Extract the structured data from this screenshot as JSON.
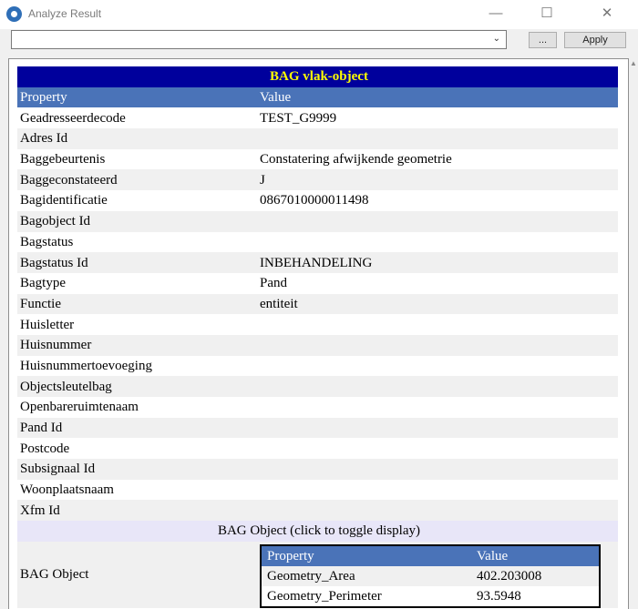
{
  "window": {
    "title": "Analyze Result",
    "minimize": "—",
    "maximize": "☐",
    "close": "✕"
  },
  "toolbar": {
    "select_value": "",
    "browse_label": "...",
    "apply_label": "Apply"
  },
  "table": {
    "title": "BAG vlak-object",
    "columns": [
      "Property",
      "Value"
    ],
    "rows": [
      {
        "property": "Geadresseerdecode",
        "value": "TEST_G9999"
      },
      {
        "property": "Adres Id",
        "value": ""
      },
      {
        "property": "Baggebeurtenis",
        "value": "Constatering afwijkende geometrie"
      },
      {
        "property": "Baggeconstateerd",
        "value": "J"
      },
      {
        "property": "Bagidentificatie",
        "value": "0867010000011498"
      },
      {
        "property": "Bagobject Id",
        "value": ""
      },
      {
        "property": "Bagstatus",
        "value": ""
      },
      {
        "property": "Bagstatus Id",
        "value": "INBEHANDELING"
      },
      {
        "property": "Bagtype",
        "value": "Pand"
      },
      {
        "property": "Functie",
        "value": "entiteit"
      },
      {
        "property": "Huisletter",
        "value": ""
      },
      {
        "property": "Huisnummer",
        "value": ""
      },
      {
        "property": "Huisnummertoevoeging",
        "value": ""
      },
      {
        "property": "Objectsleutelbag",
        "value": ""
      },
      {
        "property": "Openbareruimtenaam",
        "value": ""
      },
      {
        "property": "Pand Id",
        "value": ""
      },
      {
        "property": "Postcode",
        "value": ""
      },
      {
        "property": "Subsignaal Id",
        "value": ""
      },
      {
        "property": "Woonplaatsnaam",
        "value": ""
      },
      {
        "property": "Xfm Id",
        "value": ""
      }
    ],
    "toggle_label": "BAG Object (click to toggle display)",
    "object_label": "BAG Object",
    "inner": {
      "columns": [
        "Property",
        "Value"
      ],
      "rows": [
        {
          "property": "Geometry_Area",
          "value": "402.203008"
        },
        {
          "property": "Geometry_Perimeter",
          "value": "93.5948"
        }
      ]
    }
  }
}
